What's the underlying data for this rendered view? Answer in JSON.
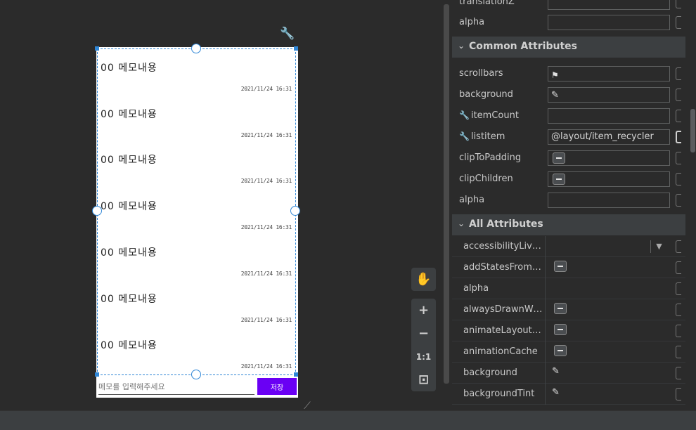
{
  "canvas": {
    "memo_items": [
      {
        "title": "00  메모내용",
        "date": "2021/11/24 16:31"
      },
      {
        "title": "00  메모내용",
        "date": "2021/11/24 16:31"
      },
      {
        "title": "00  메모내용",
        "date": "2021/11/24 16:31"
      },
      {
        "title": "00  메모내용",
        "date": "2021/11/24 16:31"
      },
      {
        "title": "00  메모내용",
        "date": "2021/11/24 16:31"
      },
      {
        "title": "00  메모내용",
        "date": "2021/11/24 16:31"
      },
      {
        "title": "00  메모내용",
        "date": "2021/11/24 16:31"
      }
    ],
    "input_placeholder": "메모를 입력해주세요",
    "save_label": "저장",
    "tools": {
      "pan": "✋",
      "zoom_in": "+",
      "zoom_out": "−",
      "actual_size": "1:1",
      "fit": "⊡"
    }
  },
  "attributes": {
    "top_rows": [
      {
        "label": "translationZ",
        "value": ""
      },
      {
        "label": "alpha",
        "value": ""
      }
    ],
    "common_title": "Common Attributes",
    "common_rows": [
      {
        "label": "scrollbars",
        "value": ""
      },
      {
        "label": "background",
        "value": ""
      },
      {
        "label": "itemCount",
        "value": ""
      },
      {
        "label": "listitem",
        "value": "@layout/item_recycler"
      },
      {
        "label": "clipToPadding",
        "value": ""
      },
      {
        "label": "clipChildren",
        "value": ""
      },
      {
        "label": "alpha",
        "value": ""
      }
    ],
    "all_title": "All Attributes",
    "all_rows": [
      {
        "label": "accessibilityLiveRe..."
      },
      {
        "label": "addStatesFromCh..."
      },
      {
        "label": "alpha"
      },
      {
        "label": "alwaysDrawnWith..."
      },
      {
        "label": "animateLayoutCh..."
      },
      {
        "label": "animationCache"
      },
      {
        "label": "background"
      },
      {
        "label": "backgroundTint"
      }
    ]
  },
  "icons": {
    "wrench": "wrench-icon",
    "flag": "flag-icon",
    "eyedropper": "eyedropper-icon",
    "chevron": "chevron-down-icon"
  },
  "colors": {
    "accent": "#2f86d6",
    "save_button": "#6a00f4",
    "panel_bg": "#2b2b2b",
    "section_bg": "#3c3f41"
  }
}
